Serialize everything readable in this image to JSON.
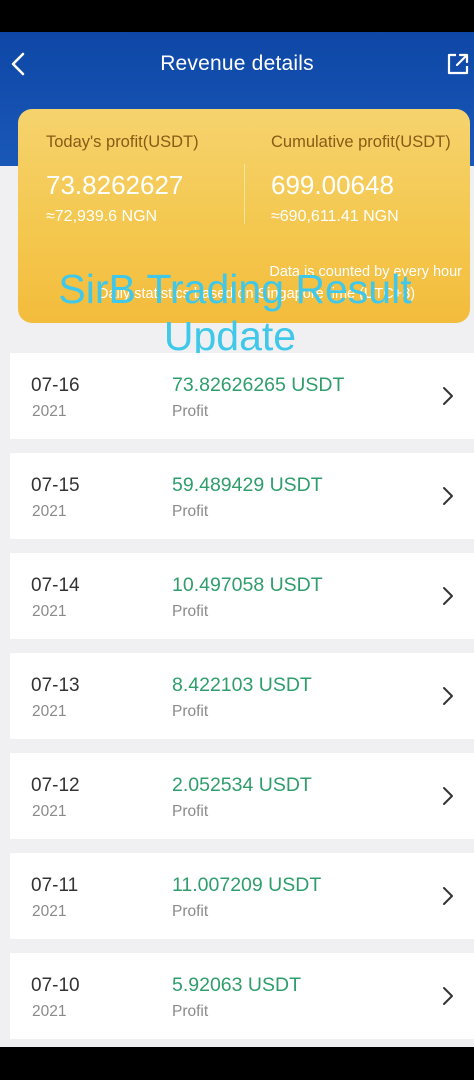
{
  "header": {
    "title": "Revenue details"
  },
  "card": {
    "today_label": "Today's profit(USDT)",
    "today_value": "73.8262627",
    "today_ngn": "≈72,939.6 NGN",
    "cumulative_label": "Cumulative profit(USDT)",
    "cumulative_value": "699.00648",
    "cumulative_ngn": "≈690,611.41 NGN",
    "note_line1": "Data is counted by every hour",
    "note_line2": "Daily statistics based on Singapore time (UTC+8)"
  },
  "watermark": {
    "line1": "SirB Trading Result",
    "line2": "Update"
  },
  "records": [
    {
      "date": "07-16",
      "year": "2021",
      "amount": "73.82626265 USDT",
      "type": "Profit"
    },
    {
      "date": "07-15",
      "year": "2021",
      "amount": "59.489429 USDT",
      "type": "Profit"
    },
    {
      "date": "07-14",
      "year": "2021",
      "amount": "10.497058 USDT",
      "type": "Profit"
    },
    {
      "date": "07-13",
      "year": "2021",
      "amount": "8.422103 USDT",
      "type": "Profit"
    },
    {
      "date": "07-12",
      "year": "2021",
      "amount": "2.052534 USDT",
      "type": "Profit"
    },
    {
      "date": "07-11",
      "year": "2021",
      "amount": "11.007209 USDT",
      "type": "Profit"
    },
    {
      "date": "07-10",
      "year": "2021",
      "amount": "5.92063 USDT",
      "type": "Profit"
    }
  ],
  "icons": {
    "back": "chevron-left-icon",
    "share": "external-link-icon",
    "row_arrow": "chevron-right-icon"
  },
  "colors": {
    "header_blue": "#0e47a6",
    "card_gold": "#f4c84f",
    "profit_green": "#2f9d6c",
    "watermark_cyan": "#3fc8ea"
  }
}
